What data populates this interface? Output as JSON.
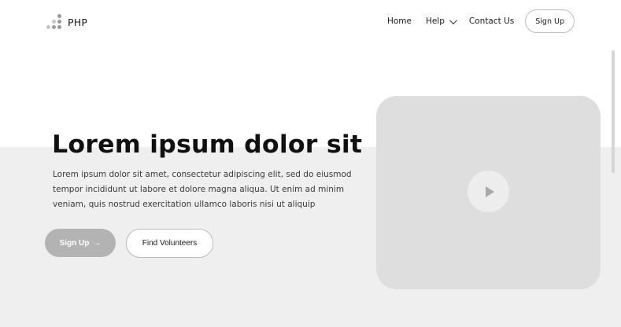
{
  "header": {
    "logo_text": "PHP",
    "nav": {
      "home": "Home",
      "help": "Help",
      "contact": "Contact Us",
      "signup": "Sign Up"
    }
  },
  "hero": {
    "title": "Lorem ipsum dolor sit",
    "description": "Lorem ipsum dolor sit amet, consectetur adipiscing elit, sed do eiusmod tempor incididunt ut labore et dolore magna aliqua. Ut enim ad minim veniam, quis nostrud exercitation ullamco laboris nisi ut aliquip",
    "primary_button": "Sign Up",
    "primary_arrow": "→",
    "secondary_button": "Find Volunteers"
  },
  "icons": {
    "logo": "dots-logo-icon",
    "help_chevron": "chevron-down-icon",
    "video": "play-icon"
  },
  "colors": {
    "band": "#efefef",
    "video_card": "#dedede",
    "primary_button": "#b3b3b3"
  }
}
